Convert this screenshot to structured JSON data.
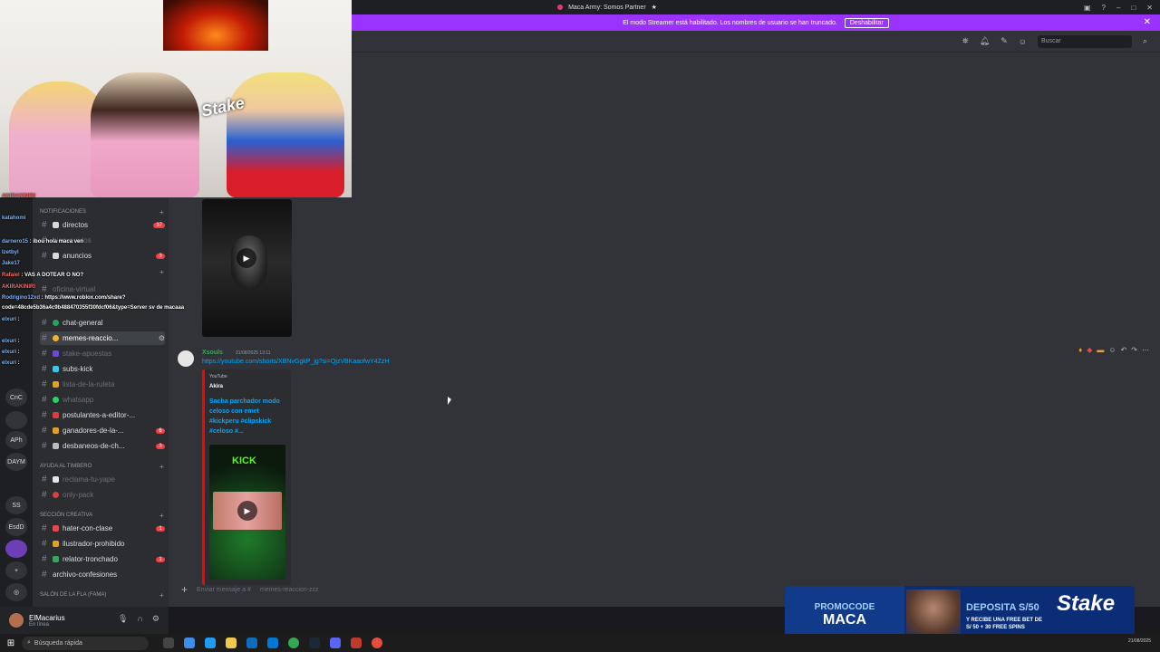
{
  "window": {
    "title": "Maca Army: Somos Partner",
    "title_star": "★"
  },
  "banner": {
    "text": "El modo Streamer está habilitado. Los nombres de usuario se han truncado.",
    "button": "Deshabilitar"
  },
  "toolbar": {
    "search_placeholder": "Buscar"
  },
  "rail": {
    "servers": [
      "APh",
      "DAYM",
      "SS",
      "EsdD",
      "CnC"
    ]
  },
  "sidebar": {
    "categories": {
      "notifications": "NOTIFICACIONES",
      "help": "AYUDA AL TIMBERO",
      "creative": "SECCIÓN CREATIVA",
      "fame": "SALÓN DE LA FLA (FAMA)"
    },
    "channels": [
      {
        "name": "directos",
        "badge": "37"
      },
      {
        "name": "bienvenidos",
        "badge": ""
      },
      {
        "name": "anuncios",
        "badge": "3"
      },
      {
        "name": "oficina-virtual",
        "badge": ""
      },
      {
        "name": "chat-general",
        "badge": ""
      },
      {
        "name": "memes-reaccio...",
        "badge": ""
      },
      {
        "name": "stake-apuestas",
        "badge": ""
      },
      {
        "name": "subs-kick",
        "badge": ""
      },
      {
        "name": "lista-de-la-ruleta",
        "badge": ""
      },
      {
        "name": "whatsapp",
        "badge": ""
      },
      {
        "name": "postulantes-a-editor-...",
        "badge": ""
      },
      {
        "name": "ganadores-de-la-...",
        "badge": "6"
      },
      {
        "name": "desbaneos-de-ch...",
        "badge": "3"
      },
      {
        "name": "reclama-tu-yape",
        "badge": ""
      },
      {
        "name": "only-pack",
        "badge": ""
      },
      {
        "name": "hater-con-clase",
        "badge": "1"
      },
      {
        "name": "ilustrador-prohibido",
        "badge": ""
      },
      {
        "name": "relator-tronchado",
        "badge": "1"
      },
      {
        "name": "archivo-confesiones",
        "badge": ""
      }
    ]
  },
  "user": {
    "name": "ElMacarius",
    "status": "En línea"
  },
  "message": {
    "author": "Xsouls",
    "timestamp": "21/08/2025 13:11",
    "link": "https://youtube.com/shorts/XBNvGgkP_jg?si=QjzVBKaaofwY4ZzH",
    "embed_provider": "YouTube",
    "embed_author": "Akira",
    "embed_title": "Sacha parchador modo celoso con emet #kickperu #clipskick #celoso #...",
    "thumb_brand": "KICK"
  },
  "composer": {
    "placeholder": "Enviar mensaje a #",
    "channel": "memes-reaccion-zzz"
  },
  "chat_overlay": [
    {
      "user": "AKIRAKINIRI",
      "text": ""
    },
    {
      "user": "katahomi",
      "text": ""
    },
    {
      "user": "darnero15",
      "text": "ibou hola maca ven"
    },
    {
      "user": "Izetbyl",
      "text": ""
    },
    {
      "user": "Jake17",
      "text": ""
    },
    {
      "user": "Rafaiel",
      "text": "VAS A DOTEAR O NO?"
    },
    {
      "user": "AKIRAKINIRI",
      "text": ""
    },
    {
      "user": "Rodrigino12xd",
      "text": "https://www.roblox.com/share?"
    },
    {
      "user": "",
      "text": "code=48cde5b36a4c9b488470355f30fdcf06&type=Server sv de macaaa"
    },
    {
      "user": "elxuri",
      "text": ""
    },
    {
      "user": "elxuri",
      "text": ""
    },
    {
      "user": "elxuri",
      "text": ""
    },
    {
      "user": "elxuri",
      "text": ""
    }
  ],
  "ad": {
    "promo_label": "PROMOCODE",
    "promo_code": "MACA",
    "deposit": "DEPOSITA S/50",
    "free_text": "Y RECIBE UNA FREE BET DE S/ 50 + 30 FREE SPINS",
    "brand": "Stake"
  },
  "taskbar": {
    "search": "Búsqueda rápida",
    "date": "21/08/2025"
  },
  "cam_overlay_text": "Stake",
  "colors": {
    "accent": "#9b33ff",
    "link": "#00a8fc",
    "badge": "#f23f43",
    "author": "#3ba55d"
  }
}
